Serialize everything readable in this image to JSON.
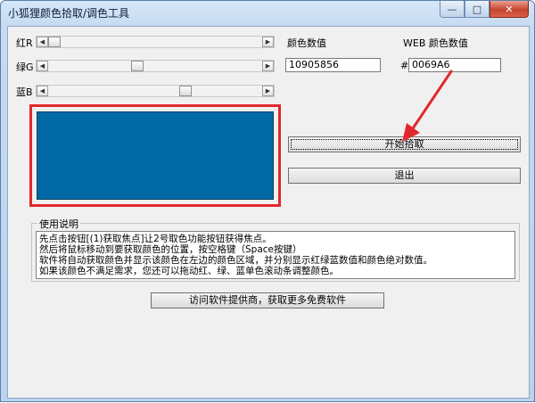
{
  "window": {
    "title": "小狐狸颜色拾取/调色工具",
    "controls": {
      "minimize": "—",
      "maximize": "□",
      "close": "✕"
    }
  },
  "sliders": [
    {
      "label": "红R",
      "value_fraction": 0.0
    },
    {
      "label": "绿G",
      "value_fraction": 0.41
    },
    {
      "label": "蓝B",
      "value_fraction": 0.65
    }
  ],
  "color_value": {
    "label": "颜色数值",
    "value": "10905856"
  },
  "web_color": {
    "label": "WEB 颜色数值",
    "prefix": "#",
    "value": "0069A6"
  },
  "preview": {
    "color": "#0069A6"
  },
  "buttons": {
    "start_pick": "开始拾取",
    "exit": "退出",
    "visit": "访问软件提供商，获取更多免费软件"
  },
  "instructions": {
    "title": "使用说明",
    "lines": [
      "先点击按钮[(1)获取焦点]让2号取色功能按钮获得焦点。",
      "然后将鼠标移动到要获取颜色的位置，按空格键（Space按键）",
      "软件将自动获取颜色并显示该颜色在左边的颜色区域，并分别显示红绿蓝数值和颜色绝对数值。",
      "如果该颜色不满足需求，您还可以拖动红、绿、蓝单色滚动条调整颜色。"
    ]
  },
  "colors": {
    "annotation_red": "#e2282c",
    "swatch": "#0069A6"
  }
}
